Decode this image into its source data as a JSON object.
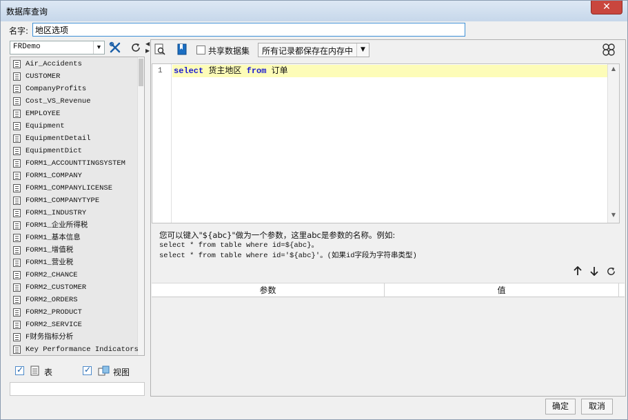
{
  "window": {
    "title": "数据库查询",
    "close_label": "✕"
  },
  "name_row": {
    "label": "名字:",
    "value": "地区选项"
  },
  "left": {
    "db_select": "FRDemo",
    "tables": [
      "Air_Accidents",
      "CUSTOMER",
      "CompanyProfits",
      "Cost_VS_Revenue",
      "EMPLOYEE",
      "Equipment",
      "EquipmentDetail",
      "EquipmentDict",
      "FORM1_ACCOUNTTINGSYSTEM",
      "FORM1_COMPANY",
      "FORM1_COMPANYLICENSE",
      "FORM1_COMPANYTYPE",
      "FORM1_INDUSTRY",
      "FORM1_企业所得税",
      "FORM1_基本信息",
      "FORM1_增值税",
      "FORM1_营业税",
      "FORM2_CHANCE",
      "FORM2_CUSTOMER",
      "FORM2_ORDERS",
      "FORM2_PRODUCT",
      "FORM2_SERVICE",
      "F财务指标分析",
      "Key Performance Indicators"
    ],
    "table_checkbox_label": "表",
    "view_checkbox_label": "视图"
  },
  "right": {
    "share_label": "共享数据集",
    "memory_select": "所有记录都保存在内存中",
    "editor": {
      "line_number": "1",
      "kw_select": "select",
      "field": " 货主地区 ",
      "kw_from": "from",
      "table": " 订单"
    },
    "hint": {
      "line1": "您可以键入\"${abc}\"做为一个参数，这里abc是参数的名称。例如:",
      "line2": "select * from table where id=${abc}。",
      "line3": "select * from table where id='${abc}'。(如果id字段为字符串类型)"
    },
    "param_headers": [
      "参数",
      "值"
    ]
  },
  "footer": {
    "ok_label": "确定",
    "cancel_label": "取消"
  },
  "colors": {
    "accent": "#3c8fd6",
    "close": "#c9463d",
    "keyword": "#1a1ad0",
    "highlight": "#fdfcb8"
  }
}
